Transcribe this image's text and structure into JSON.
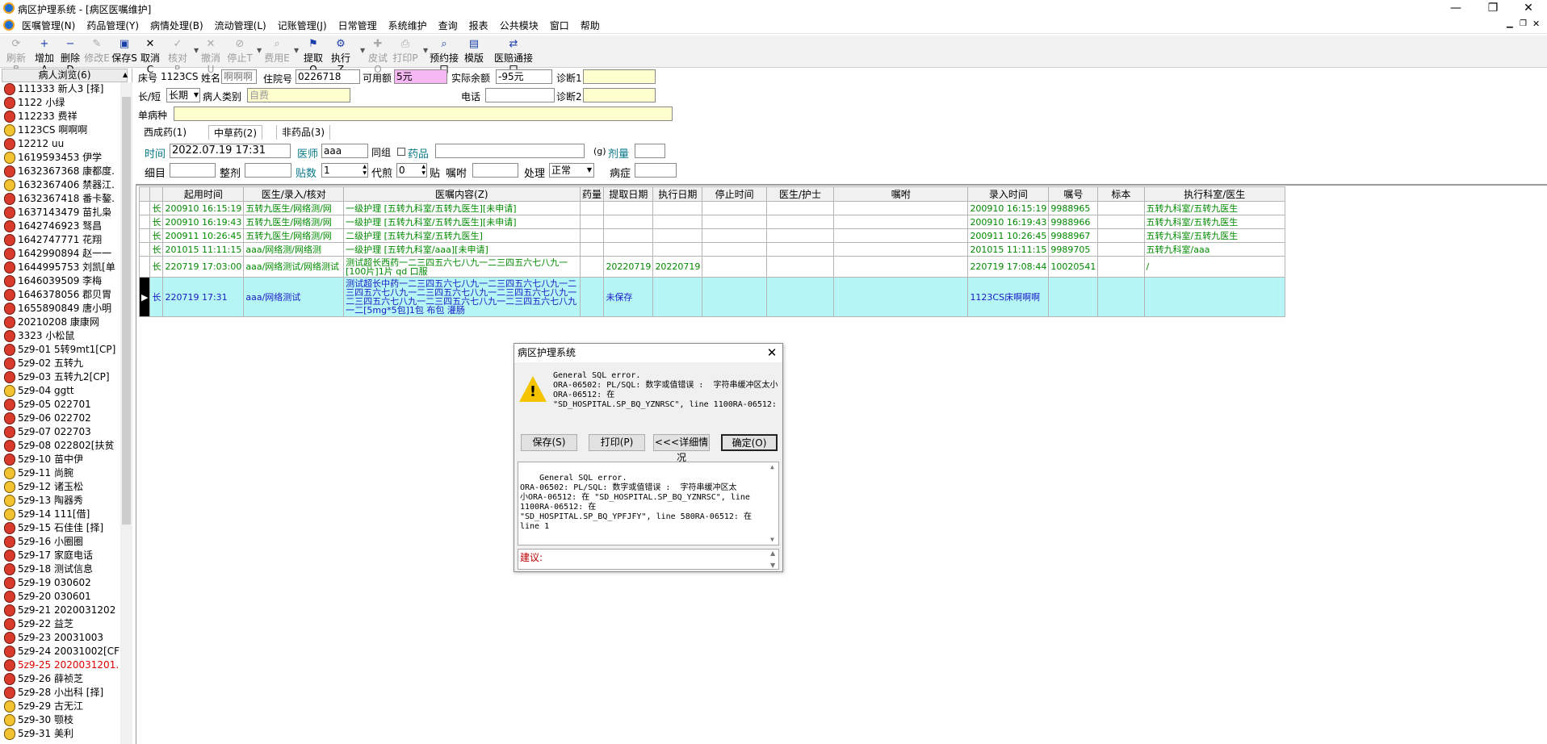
{
  "window": {
    "title": "病区护理系统 - [病区医嘱维护]"
  },
  "menu": [
    "医嘱管理(N)",
    "药品管理(Y)",
    "病情处理(B)",
    "流动管理(L)",
    "记账管理(J)",
    "日常管理",
    "系统维护",
    "查询",
    "报表",
    "公共模块",
    "窗口",
    "帮助"
  ],
  "toolbar": [
    {
      "label": "刷新B",
      "icon": "refresh-icon",
      "glyph": "⟳",
      "disabled": true
    },
    {
      "label": "增加A",
      "icon": "add-icon",
      "glyph": "+",
      "disabled": false
    },
    {
      "label": "删除D",
      "icon": "delete-icon",
      "glyph": "−",
      "disabled": false
    },
    {
      "label": "修改E",
      "icon": "edit-icon",
      "glyph": "✎",
      "disabled": true
    },
    {
      "label": "保存S",
      "icon": "save-icon",
      "glyph": "▣",
      "disabled": false
    },
    {
      "label": "取消C",
      "icon": "cancel-icon",
      "glyph": "✕",
      "disabled": false
    },
    {
      "label": "核对R",
      "icon": "check-icon",
      "glyph": "✓",
      "disabled": true
    },
    {
      "label": "撤消U",
      "icon": "undo-icon",
      "glyph": "✕",
      "disabled": true
    },
    {
      "label": "停止T",
      "icon": "stop-icon",
      "glyph": "⊘",
      "disabled": true
    },
    {
      "label": "费用E",
      "icon": "fee-icon",
      "glyph": "⌕",
      "disabled": true
    },
    {
      "label": "提取Q",
      "icon": "extract-icon",
      "glyph": "⚑",
      "disabled": false
    },
    {
      "label": "执行Z",
      "icon": "execute-icon",
      "glyph": "⚙",
      "disabled": false
    },
    {
      "label": "皮试O",
      "icon": "skin-test-icon",
      "glyph": "✚",
      "disabled": true
    },
    {
      "label": "打印P",
      "icon": "print-icon",
      "glyph": "⎙",
      "disabled": true
    },
    {
      "label": "预约接口",
      "icon": "appointment-icon",
      "glyph": "⌕",
      "disabled": false
    },
    {
      "label": "模版",
      "icon": "template-icon",
      "glyph": "▤",
      "disabled": false
    },
    {
      "label": "医赔通接口",
      "icon": "insurance-icon",
      "glyph": "⇄",
      "disabled": false
    }
  ],
  "patient_panel": {
    "header": "病人浏览(6)",
    "items": [
      {
        "text": "111333 新人3 [择]",
        "face": "r"
      },
      {
        "text": "1122 小绿",
        "face": "r"
      },
      {
        "text": "112233 费祥",
        "face": "r"
      },
      {
        "text": "1123CS 啊啊啊",
        "face": "y"
      },
      {
        "text": "12212 uu",
        "face": "r"
      },
      {
        "text": "1619593453 伊学",
        "face": "y"
      },
      {
        "text": "1632367368 康都度.",
        "face": "r"
      },
      {
        "text": "1632367406 禁器江.",
        "face": "y"
      },
      {
        "text": "1632367418 番卡鏊.",
        "face": "r"
      },
      {
        "text": "1637143479 苗扎枭",
        "face": "r"
      },
      {
        "text": "1642746923 驽昌",
        "face": "r"
      },
      {
        "text": "1642747771 花翔",
        "face": "r"
      },
      {
        "text": "1642990894 赵一一",
        "face": "r"
      },
      {
        "text": "1644995753 刘凯[单",
        "face": "r"
      },
      {
        "text": "1646039509 李梅",
        "face": "r"
      },
      {
        "text": "1646378056 郡贝胃",
        "face": "r"
      },
      {
        "text": "1655890849 唐小明",
        "face": "r"
      },
      {
        "text": "20210208 康康网",
        "face": "r"
      },
      {
        "text": "3323 小松鼠",
        "face": "r"
      },
      {
        "text": "5z9-01 5转9mt1[CP]",
        "face": "r"
      },
      {
        "text": "5z9-02 五转九",
        "face": "r"
      },
      {
        "text": "5z9-03 五转九2[CP]",
        "face": "r"
      },
      {
        "text": "5z9-04 ggtt",
        "face": "y"
      },
      {
        "text": "5z9-05 022701",
        "face": "r"
      },
      {
        "text": "5z9-06 022702",
        "face": "r"
      },
      {
        "text": "5z9-07 022703",
        "face": "r"
      },
      {
        "text": "5z9-08 022802[扶贫",
        "face": "r"
      },
      {
        "text": "5z9-10 苗中伊",
        "face": "r"
      },
      {
        "text": "5z9-11 尚腕",
        "face": "y"
      },
      {
        "text": "5z9-12 诸玉松",
        "face": "y"
      },
      {
        "text": "5z9-13 陶器秀",
        "face": "y"
      },
      {
        "text": "5z9-14 111[借]",
        "face": "y"
      },
      {
        "text": "5z9-15 石佳佳 [择]",
        "face": "r"
      },
      {
        "text": "5z9-16 小圈圈",
        "face": "r"
      },
      {
        "text": "5z9-17 家庭电话",
        "face": "r"
      },
      {
        "text": "5z9-18 测试信息",
        "face": "r"
      },
      {
        "text": "5z9-19 030602",
        "face": "r"
      },
      {
        "text": "5z9-20 030601",
        "face": "r"
      },
      {
        "text": "5z9-21 2020031202",
        "face": "r"
      },
      {
        "text": "5z9-22 益芝",
        "face": "r"
      },
      {
        "text": "5z9-23 20031003",
        "face": "r"
      },
      {
        "text": "5z9-24 20031002[CF",
        "face": "r"
      },
      {
        "text": "5z9-25 2020031201.",
        "face": "r",
        "red": true
      },
      {
        "text": "5z9-26 薛祯芝",
        "face": "r"
      },
      {
        "text": "5z9-28 小出科 [择]",
        "face": "r"
      },
      {
        "text": "5z9-29 古无江",
        "face": "y"
      },
      {
        "text": "5z9-30 颚枝",
        "face": "y"
      },
      {
        "text": "5z9-31 美利",
        "face": "y"
      }
    ]
  },
  "form": {
    "bed_label": "床号",
    "bed_value": "1123CS",
    "name_label": "姓名",
    "name_value": "啊啊啊",
    "inpatient_label": "住院号",
    "inpatient_value": "0226718",
    "available_label": "可用额",
    "available_value": "5元",
    "balance_label": "实际余额",
    "balance_value": "-95元",
    "diag1_label": "诊断1",
    "diag1_value": "",
    "type_label": "长/短",
    "type_value": "长期",
    "category_label": "病人类别",
    "category_value": "自费",
    "phone_label": "电话",
    "phone_value": "",
    "diag2_label": "诊断2",
    "diag2_value": "",
    "single_label": "单病种",
    "single_value": ""
  },
  "tabs": [
    "西成药(1)",
    "中草药(2)",
    "非药品(3)"
  ],
  "order_form": {
    "time_label": "时间",
    "time_value": "2022.07.19 17:31",
    "doctor_label": "医师",
    "doctor_value": "aaa",
    "group_label": "同组",
    "drug_label": "药品",
    "drug_value": "",
    "g_label": "(g)",
    "dose_label": "剂量",
    "dose_value": "",
    "detail_label": "细目",
    "detail_value": "",
    "whole_label": "整剂",
    "whole_value": "",
    "count_label": "贴数",
    "count_value": "1",
    "decoct_label": "代煎",
    "decoct_value": "0",
    "tie_label": "贴",
    "note_label": "嘱咐",
    "note_value": "",
    "handle_label": "处理",
    "handle_value": "正常",
    "illness_label": "病症",
    "illness_value": ""
  },
  "grid": {
    "headers": [
      "",
      "",
      "起用时间",
      "医生/录入/核对",
      "医嘱内容(Z)",
      "药量",
      "提取日期",
      "执行日期",
      "停止时间",
      "医生/护士",
      "嘱咐",
      "录入时间",
      "嘱号",
      "标本",
      "执行科室/医生"
    ],
    "rows": [
      {
        "style": "g",
        "cells": [
          "",
          "长",
          "200910 16:15:19",
          "五转九医生/网络测/网",
          "一级护理   [五转九科室/五转九医生][未申请]",
          "",
          "",
          "",
          "",
          "",
          "",
          "200910 16:15:19",
          "9988965",
          "",
          "五转九科室/五转九医生"
        ]
      },
      {
        "style": "g",
        "cells": [
          "",
          "长",
          "200910 16:19:43",
          "五转九医生/网络测/网",
          "一级护理   [五转九科室/五转九医生][未申请]",
          "",
          "",
          "",
          "",
          "",
          "",
          "200910 16:19:43",
          "9988966",
          "",
          "五转九科室/五转九医生"
        ]
      },
      {
        "style": "g",
        "cells": [
          "",
          "长",
          "200911 10:26:45",
          "五转九医生/网络测/网",
          "二级护理   [五转九科室/五转九医生]",
          "",
          "",
          "",
          "",
          "",
          "",
          "200911 10:26:45",
          "9988967",
          "",
          "五转九科室/五转九医生"
        ]
      },
      {
        "style": "g",
        "cells": [
          "",
          "长",
          "201015 11:11:15",
          "aaa/网络测/网络测",
          "一级护理   [五转九科室/aaa][未申请]",
          "",
          "",
          "",
          "",
          "",
          "",
          "201015 11:11:15",
          "9989705",
          "",
          "五转九科室/aaa"
        ]
      },
      {
        "style": "g2",
        "cells": [
          "",
          "长",
          "220719 17:03:00",
          "aaa/网络测试/网络测试",
          "测试超长西药一二三四五六七八九一二三四五六七八九一[100片]1片 qd 口服",
          "",
          "20220719",
          "20220719",
          "",
          "",
          "",
          "220719 17:08:44",
          "10020541",
          "",
          "/"
        ]
      },
      {
        "style": "sel",
        "cells": [
          "▶",
          "长",
          "220719 17:31",
          "aaa/网络测试",
          "测试超长中药一二三四五六七八九一二三四五六七八九一二三四五六七八九一二三四五六七八九一二三四五六七八九一二三四五六七八九一二三四五六七八九一二三四五六七八九一二[5mg*5包]1包 布包 灌肠",
          "",
          "未保存",
          "",
          "",
          "",
          "",
          "1123CS床啊啊啊",
          "",
          "",
          ""
        ]
      }
    ]
  },
  "dialog": {
    "title": "病区护理系统",
    "message": "General SQL error.\nORA-06502: PL/SQL: 数字或值错误 :  字符串缓冲区太小ORA-06512: 在\n\"SD_HOSPITAL.SP_BQ_YZNRSC\", line 1100RA-06512:",
    "buttons": {
      "save": "保存(S)",
      "print": "打印(P)",
      "detail": "<<<详细情况",
      "ok": "确定(O)"
    },
    "detail": "General SQL error.\nORA-06502: PL/SQL: 数字或值错误 :  字符串缓冲区太\n小ORA-06512: 在 \"SD_HOSPITAL.SP_BQ_YZNRSC\", line\n1100RA-06512: 在\n\"SD_HOSPITAL.SP_BQ_YPFJFY\", line 580RA-06512: 在\nline 1",
    "suggest_label": "建议:"
  }
}
